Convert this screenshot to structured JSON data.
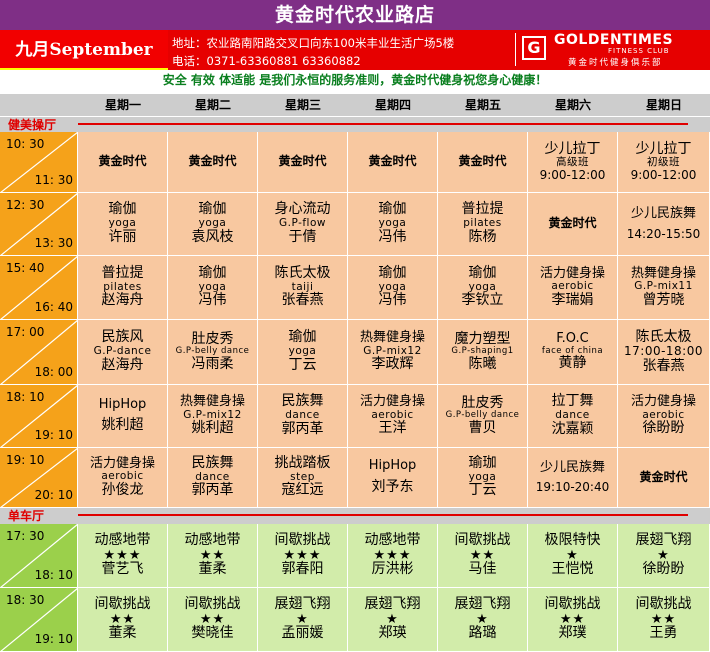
{
  "header": {
    "title": "黄金时代农业路店",
    "month": "九月September",
    "address": "地址：农业路南阳路交叉口向东100米丰业生活广场5楼",
    "phone": "电话：0371-63360881 63360882",
    "logo_mark": "G",
    "logo_name": "GOLDENTIMES",
    "logo_sub": "FITNESS CLUB",
    "logo_cn": "黄金时代健身俱乐部"
  },
  "slogan": "安全  有效  体适能  是我们永恒的服务准则，黄金时代健身祝您身心健康！",
  "days": [
    "星期一",
    "星期二",
    "星期三",
    "星期四",
    "星期五",
    "星期六",
    "星期日"
  ],
  "colors": {
    "title_bg": "#7f2f86",
    "header_red": "#e60000",
    "aerobic_time": "#f5a21a",
    "aerobic_cell": "#f8c8a0",
    "spin_time": "#9bd04b",
    "spin_cell": "#d2ecaa",
    "slogan": "#0a7f1f"
  },
  "sections": [
    {
      "label": "健美操厅",
      "rows": [
        {
          "start": "10: 30",
          "end": "11: 30",
          "cells": [
            [
              "黄金时代"
            ],
            [
              "黄金时代"
            ],
            [
              "黄金时代"
            ],
            [
              "黄金时代"
            ],
            [
              "黄金时代"
            ],
            [
              "少儿拉丁",
              "高级班",
              "9:00-12:00"
            ],
            [
              "少儿拉丁",
              "初级班",
              "9:00-12:00"
            ]
          ]
        },
        {
          "start": "12: 30",
          "end": "13: 30",
          "cells": [
            [
              "瑜伽",
              "yoga",
              "许丽"
            ],
            [
              "瑜伽",
              "yoga",
              "袁风枝"
            ],
            [
              "身心流动",
              "G.P-flow",
              "于倩"
            ],
            [
              "瑜伽",
              "yoga",
              "冯伟"
            ],
            [
              "普拉提",
              "pilates",
              "陈杨"
            ],
            [
              "黄金时代"
            ],
            [
              "少儿民族舞",
              "",
              "14:20-15:50"
            ]
          ]
        },
        {
          "start": "15: 40",
          "end": "16: 40",
          "cells": [
            [
              "普拉提",
              "pilates",
              "赵海舟"
            ],
            [
              "瑜伽",
              "yoga",
              "冯伟"
            ],
            [
              "陈氏太极",
              "taiji",
              "张春燕"
            ],
            [
              "瑜伽",
              "yoga",
              "冯伟"
            ],
            [
              "瑜伽",
              "yoga",
              "李钦立"
            ],
            [
              "活力健身操",
              "aerobic",
              "李瑞娟"
            ],
            [
              "热舞健身操",
              "G.P-mix11",
              "曾芳晓"
            ]
          ]
        },
        {
          "start": "17: 00",
          "end": "18: 00",
          "cells": [
            [
              "民族风",
              "G.P-dance",
              "赵海舟"
            ],
            [
              "肚皮秀",
              "G.P-belly dance",
              "冯雨柔"
            ],
            [
              "瑜伽",
              "yoga",
              "丁云"
            ],
            [
              "热舞健身操",
              "G.P-mix12",
              "李政辉"
            ],
            [
              "魔力塑型",
              "G.P-shaping1",
              "陈曦"
            ],
            [
              "F.O.C",
              "face of china",
              "黄静"
            ],
            [
              "陈氏太极",
              "17:00-18:00",
              "张春燕"
            ]
          ]
        },
        {
          "start": "18: 10",
          "end": "19: 10",
          "cells": [
            [
              "HipHop",
              "",
              "姚利超"
            ],
            [
              "热舞健身操",
              "G.P-mix12",
              "姚利超"
            ],
            [
              "民族舞",
              "dance",
              "郭丙革"
            ],
            [
              "活力健身操",
              "aerobic",
              "王洋"
            ],
            [
              "肚皮秀",
              "G.P-belly dance",
              "曹贝"
            ],
            [
              "拉丁舞",
              "dance",
              "沈嘉颖"
            ],
            [
              "活力健身操",
              "aerobic",
              "徐盼盼"
            ]
          ]
        },
        {
          "start": "19: 10",
          "end": "20: 10",
          "cells": [
            [
              "活力健身操",
              "aerobic",
              "孙俊龙"
            ],
            [
              "民族舞",
              "dance",
              "郭丙革"
            ],
            [
              "挑战踏板",
              "step",
              "寇红远"
            ],
            [
              "HipHop",
              "",
              "刘予东"
            ],
            [
              "瑜珈",
              "yoga",
              "丁云"
            ],
            [
              "少儿民族舞",
              "",
              "19:10-20:40"
            ],
            [
              "黄金时代"
            ]
          ]
        }
      ]
    },
    {
      "label": "单车厅",
      "rows": [
        {
          "start": "17: 30",
          "end": "18: 10",
          "cells": [
            [
              "动感地带",
              "★★★",
              "菅艺飞"
            ],
            [
              "动感地带",
              "★★",
              "董柔"
            ],
            [
              "间歇挑战",
              "★★★",
              "郭春阳"
            ],
            [
              "动感地带",
              "★★★",
              "厉洪彬"
            ],
            [
              "间歇挑战",
              "★★",
              "马佳"
            ],
            [
              "极限特快",
              "★",
              "王恺悦"
            ],
            [
              "展翅飞翔",
              "★",
              "徐盼盼"
            ]
          ]
        },
        {
          "start": "18: 30",
          "end": "19: 10",
          "cells": [
            [
              "间歇挑战",
              "★★",
              "董柔"
            ],
            [
              "间歇挑战",
              "★★",
              "樊晓佳"
            ],
            [
              "展翅飞翔",
              "★",
              "孟丽媛"
            ],
            [
              "展翅飞翔",
              "★",
              "郑瑛"
            ],
            [
              "展翅飞翔",
              "★",
              "路璐"
            ],
            [
              "间歇挑战",
              "★★",
              "郑璞"
            ],
            [
              "间歇挑战",
              "★★",
              "王勇"
            ]
          ]
        }
      ]
    }
  ]
}
